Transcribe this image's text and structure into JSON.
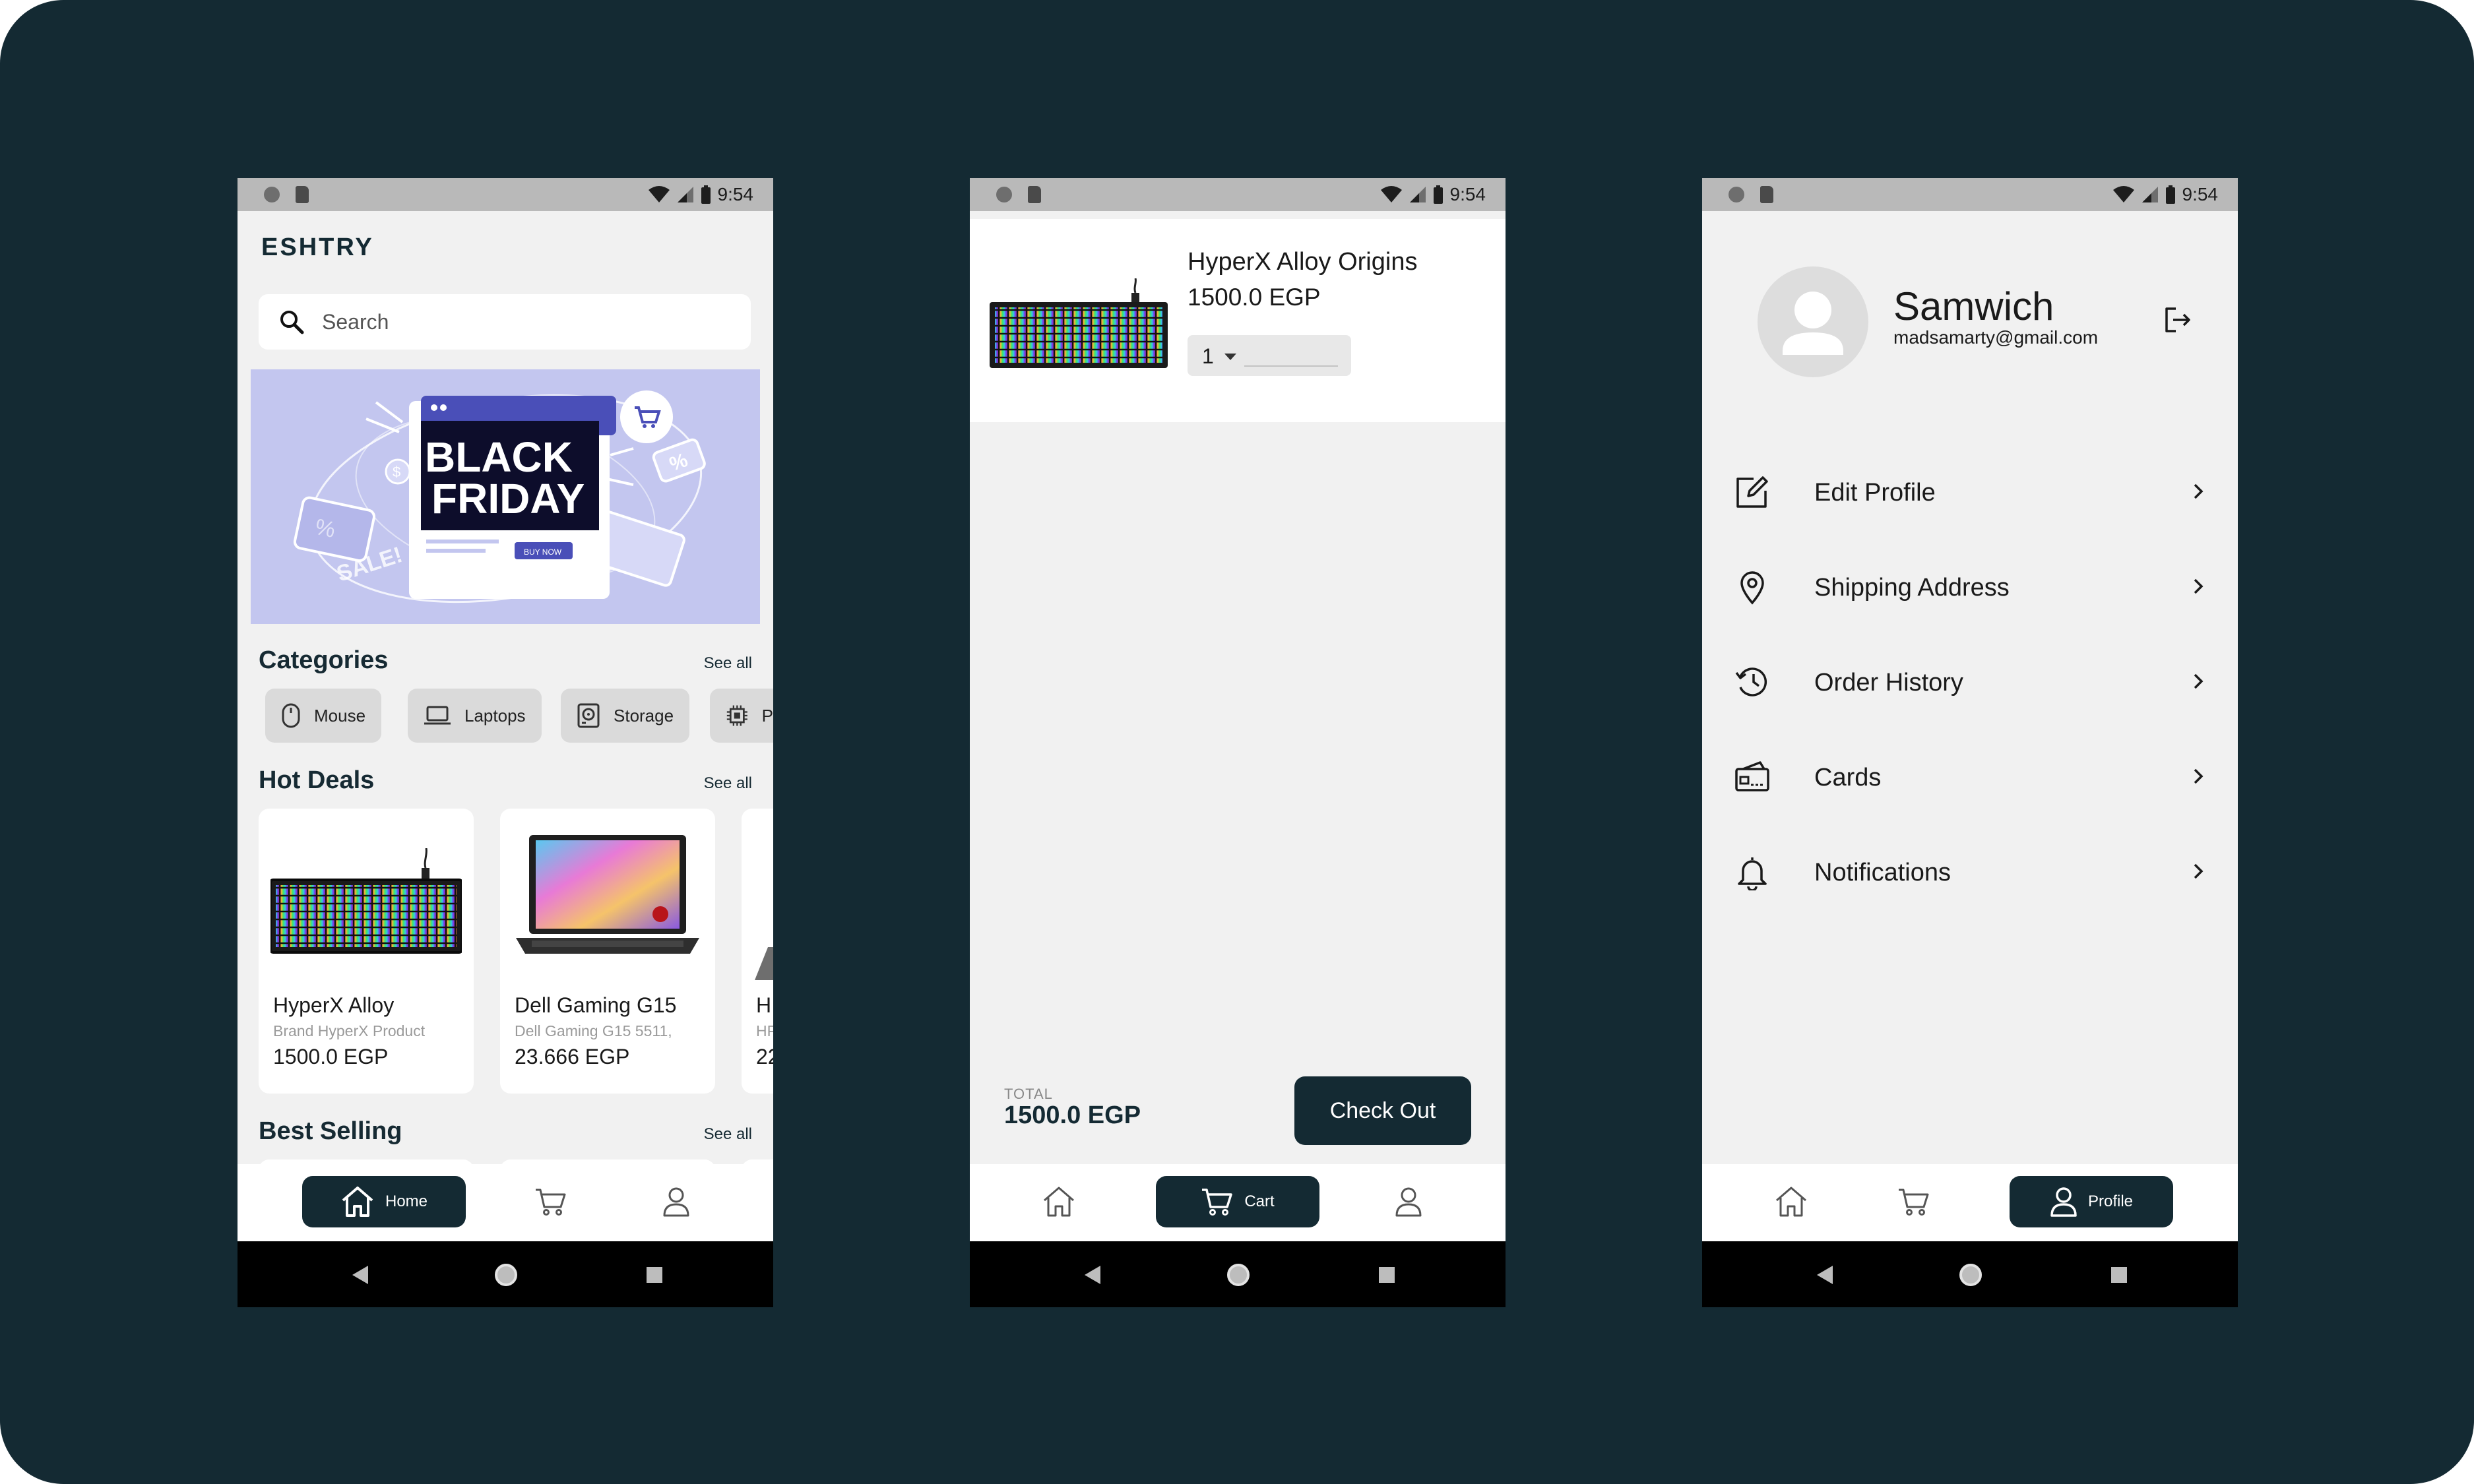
{
  "status": {
    "time": "9:54"
  },
  "home": {
    "logo": "ESHTRY",
    "search_placeholder": "Search",
    "banner": {
      "line1": "BLACK",
      "line2": "FRIDAY",
      "sale": "SALE!",
      "buy_now": "BUY NOW"
    },
    "categories": {
      "title": "Categories",
      "see_all": "See all",
      "items": [
        {
          "label": "Mouse",
          "icon": "mouse-icon"
        },
        {
          "label": "Laptops",
          "icon": "laptop-icon"
        },
        {
          "label": "Storage",
          "icon": "storage-icon"
        },
        {
          "label": "P",
          "icon": "processor-icon"
        }
      ]
    },
    "hot_deals": {
      "title": "Hot Deals",
      "see_all": "See all",
      "products": [
        {
          "name": "HyperX Alloy",
          "desc": "Brand  HyperX Product",
          "price": "1500.0 EGP"
        },
        {
          "name": "Dell Gaming G15",
          "desc": "Dell Gaming G15 5511,",
          "price": "23.666 EGP"
        },
        {
          "name": "H",
          "desc": "HP",
          "price": "22"
        }
      ]
    },
    "best_selling": {
      "title": "Best Selling",
      "see_all": "See all"
    }
  },
  "nav": {
    "home": "Home",
    "cart": "Cart",
    "profile": "Profile"
  },
  "cart": {
    "item": {
      "name": "HyperX Alloy Origins",
      "price": "1500.0 EGP",
      "quantity": "1"
    },
    "total_label": "TOTAL",
    "total_value": "1500.0 EGP",
    "checkout": "Check Out"
  },
  "profile": {
    "name": "Samwich",
    "email": "madsamarty@gmail.com",
    "menu": [
      {
        "label": "Edit Profile",
        "icon": "edit-icon"
      },
      {
        "label": "Shipping Address",
        "icon": "location-pin-icon"
      },
      {
        "label": "Order History",
        "icon": "history-icon"
      },
      {
        "label": "Cards",
        "icon": "card-icon"
      },
      {
        "label": "Notifications",
        "icon": "bell-icon"
      }
    ]
  },
  "colors": {
    "background": "#142a33",
    "accent": "#142a33",
    "banner": "#c3c6ef",
    "screen": "#f1f1f1"
  }
}
